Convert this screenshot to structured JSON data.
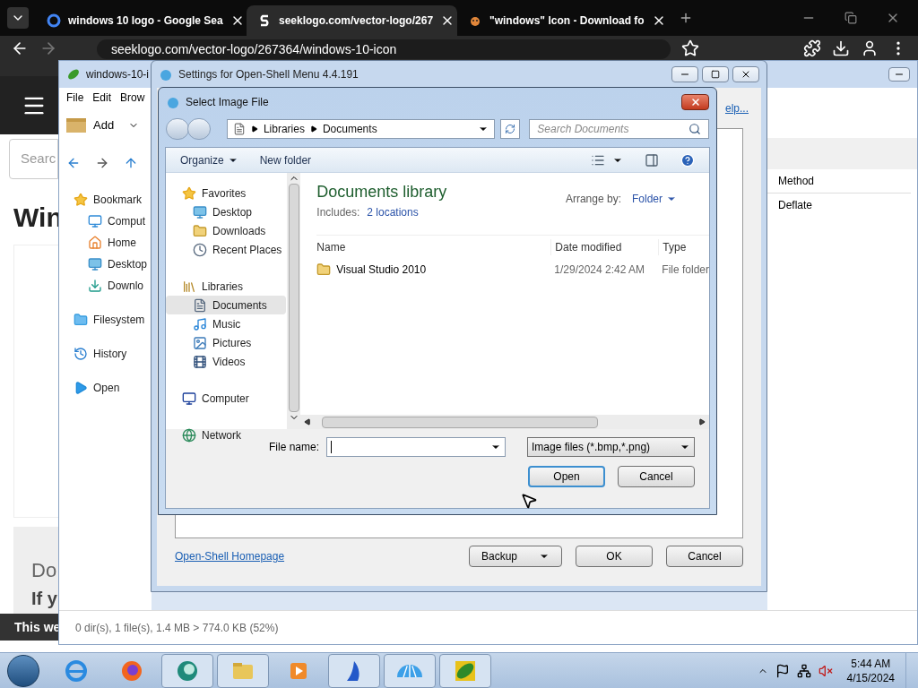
{
  "browser": {
    "tabs": [
      {
        "title": "windows 10 logo - Google Sea",
        "selected": false,
        "kind": "google"
      },
      {
        "title": "seeklogo.com/vector-logo/267",
        "selected": true,
        "kind": "s"
      },
      {
        "title": "\"windows\" Icon - Download fo",
        "selected": false,
        "kind": "bug"
      }
    ],
    "address": "seeklogo.com/vector-logo/267364/windows-10-icon",
    "page": {
      "search_placeholder": "Searc",
      "heading": "Win",
      "subheading": "Do",
      "text": "If y",
      "cookie_banner": "This we"
    }
  },
  "archive_window": {
    "title": "windows-10-i",
    "menu": [
      "File",
      "Edit",
      "Brow"
    ],
    "add_button": "Add",
    "sidebar": [
      {
        "label": "Bookmark",
        "kind": "star",
        "children": [
          {
            "label": "Comput",
            "kind": "monitor"
          },
          {
            "label": "Home",
            "kind": "home"
          },
          {
            "label": "Desktop",
            "kind": "desktop"
          },
          {
            "label": "Downlo",
            "kind": "download"
          }
        ]
      },
      {
        "label": "Filesystem",
        "kind": "folder"
      },
      {
        "label": "History",
        "kind": "history"
      },
      {
        "label": "Open",
        "kind": "play"
      }
    ],
    "columns": [
      "Method"
    ],
    "rows": [
      [
        "Deflate"
      ]
    ],
    "status": "0 dir(s), 1 file(s), 1.4 MB > 774.0 KB (52%)"
  },
  "settings_dialog": {
    "title": "Settings for Open-Shell Menu 4.4.191",
    "help_link": "elp...",
    "homepage_link": "Open-Shell Homepage",
    "buttons": [
      {
        "label": "Backup",
        "kind": "split"
      },
      {
        "label": "OK",
        "kind": "plain"
      },
      {
        "label": "Cancel",
        "kind": "plain"
      }
    ]
  },
  "file_dialog": {
    "title": "Select Image File",
    "breadcrumb": [
      "Libraries",
      "Documents"
    ],
    "search_placeholder": "Search Documents",
    "organize": "Organize",
    "new_folder": "New folder",
    "nav": [
      {
        "label": "Favorites",
        "kind": "star",
        "selected": false,
        "children": [
          {
            "label": "Desktop",
            "kind": "desktop",
            "selected": false
          },
          {
            "label": "Downloads",
            "kind": "downloads",
            "selected": false
          },
          {
            "label": "Recent Places",
            "kind": "recent",
            "selected": false
          }
        ]
      },
      {
        "label": "Libraries",
        "kind": "library",
        "selected": false,
        "children": [
          {
            "label": "Documents",
            "kind": "document",
            "selected": true
          },
          {
            "label": "Music",
            "kind": "music",
            "selected": false
          },
          {
            "label": "Pictures",
            "kind": "pictures",
            "selected": false
          },
          {
            "label": "Videos",
            "kind": "videos",
            "selected": false
          }
        ]
      },
      {
        "label": "Computer",
        "kind": "computer",
        "selected": false
      },
      {
        "label": "Network",
        "kind": "network",
        "selected": false
      }
    ],
    "library_title": "Documents library",
    "includes_label": "Includes:",
    "includes_link": "2 locations",
    "arrange_label": "Arrange by:",
    "arrange_value": "Folder",
    "columns": [
      "Name",
      "Date modified",
      "Type"
    ],
    "rows": [
      {
        "name": "Visual Studio 2010",
        "date": "1/29/2024 2:42 AM",
        "type": "File folder"
      }
    ],
    "filename_label": "File name:",
    "filter": "Image files (*.bmp,*.png)",
    "buttons": [
      {
        "label": "Open",
        "default": true
      },
      {
        "label": "Cancel",
        "default": false
      }
    ]
  },
  "taskbar": {
    "apps": [
      {
        "kind": "ie",
        "running": false
      },
      {
        "kind": "firefox",
        "running": false
      },
      {
        "kind": "green-orb",
        "running": true
      },
      {
        "kind": "explorer",
        "running": true
      },
      {
        "kind": "media",
        "running": false
      },
      {
        "kind": "sail",
        "running": true
      },
      {
        "kind": "shell",
        "running": true
      },
      {
        "kind": "peas",
        "running": true
      }
    ],
    "time": "5:44 AM",
    "date": "4/15/2024"
  }
}
